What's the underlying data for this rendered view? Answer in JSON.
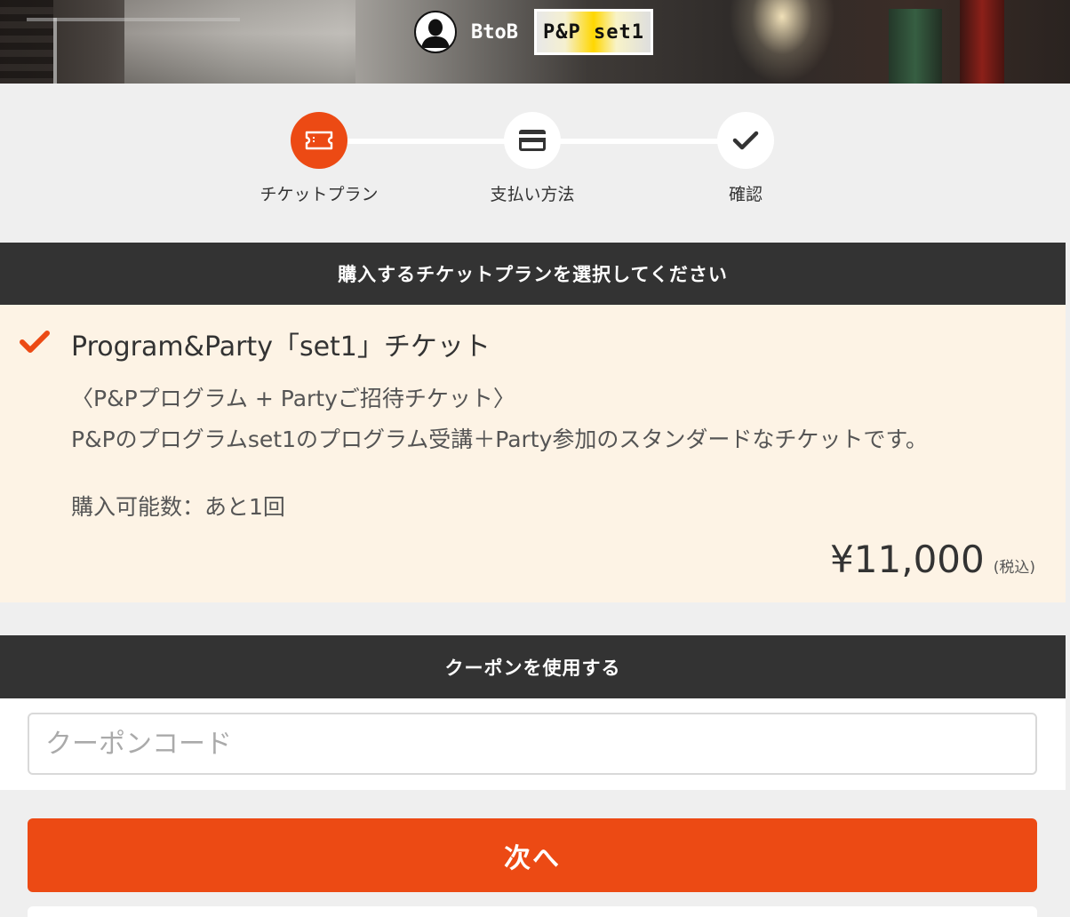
{
  "header": {
    "user_type": "BtoB",
    "plan_badge": "P&P set1"
  },
  "stepper": {
    "steps": [
      {
        "label": "チケットプラン",
        "icon": "ticket-icon",
        "active": true
      },
      {
        "label": "支払い方法",
        "icon": "credit-card-icon",
        "active": false
      },
      {
        "label": "確認",
        "icon": "check-icon",
        "active": false
      }
    ]
  },
  "plan_section": {
    "heading": "購入するチケットプランを選択してください",
    "ticket": {
      "title": "Program&Party「set1」チケット",
      "subtitle": "〈P&Pプログラム + Partyご招待チケット〉",
      "description": "P&Pのプログラムset1のプログラム受講＋Party参加のスタンダードなチケットです。",
      "remaining": "購入可能数：あと1回",
      "price": "¥11,000",
      "tax_note": "(税込)",
      "selected": true
    }
  },
  "coupon_section": {
    "heading": "クーポンを使用する",
    "placeholder": "クーポンコード",
    "value": ""
  },
  "actions": {
    "next_label": "次へ"
  },
  "colors": {
    "accent": "#ec4a14",
    "header_bg": "#333333",
    "card_bg": "#fdf3e5",
    "page_bg": "#efefef"
  }
}
